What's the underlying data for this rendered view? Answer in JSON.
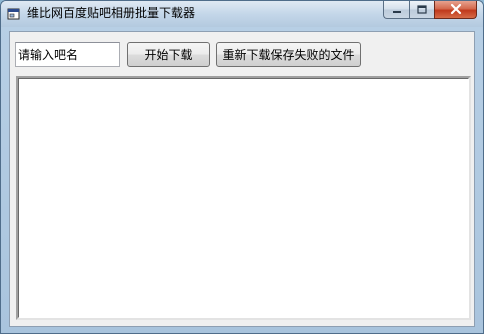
{
  "window": {
    "title": "维比网百度贴吧相册批量下载器",
    "icon": "app-window-icon"
  },
  "caption_buttons": {
    "minimize_icon": "minimize-icon",
    "maximize_icon": "maximize-icon",
    "close_icon": "close-icon"
  },
  "form": {
    "bar_name_value": "请输入吧名",
    "start_download_label": "开始下载",
    "retry_failed_label": "重新下载保存失败的文件"
  },
  "log": {
    "content": ""
  }
}
